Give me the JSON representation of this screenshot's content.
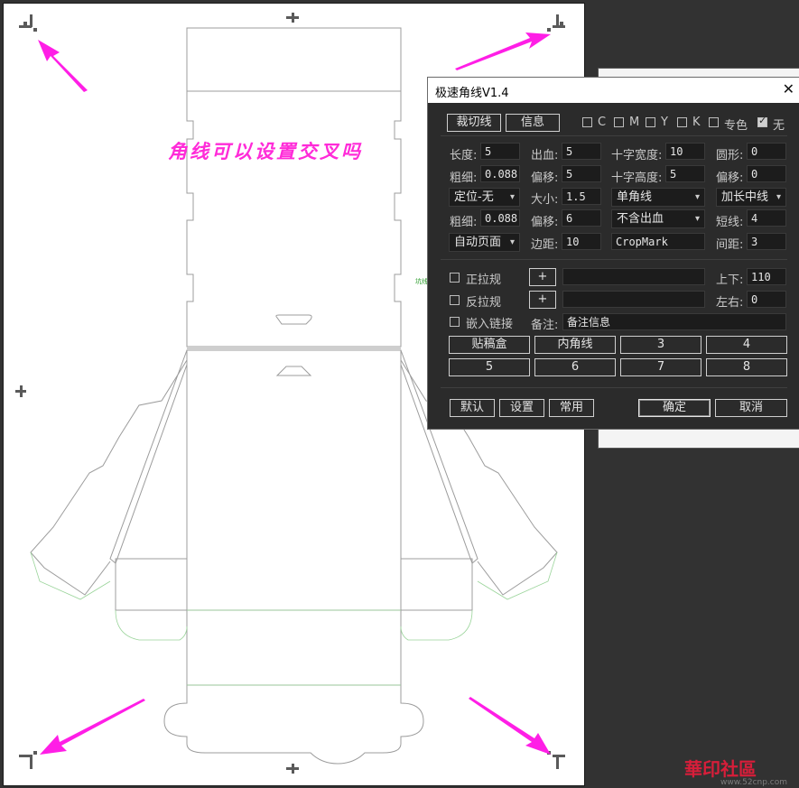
{
  "annotation_text": "角线可以设置交叉吗",
  "dialog": {
    "title": "极速角线V1.4",
    "close_glyph": "✕",
    "tabs": {
      "crop": "裁切线",
      "info": "信息"
    },
    "colors": [
      {
        "label": "C",
        "checked": false
      },
      {
        "label": "M",
        "checked": false
      },
      {
        "label": "Y",
        "checked": false
      },
      {
        "label": "K",
        "checked": false
      },
      {
        "label": "专色",
        "checked": false
      },
      {
        "label": "无",
        "checked": true
      }
    ],
    "row1": {
      "length_label": "长度:",
      "length_value": "5",
      "bleed_label": "出血:",
      "bleed_value": "5",
      "cross_width_label": "十字宽度:",
      "cross_width_value": "10",
      "circle_label": "圆形:",
      "circle_value": "0"
    },
    "row2": {
      "thickness_label": "粗细:",
      "thickness_value": "0.088",
      "offset_label": "偏移:",
      "offset_value": "5",
      "cross_height_label": "十字高度:",
      "cross_height_value": "5",
      "offset2_label": "偏移:",
      "offset2_value": "0"
    },
    "row3": {
      "position_select": "定位-无",
      "size_label": "大小:",
      "size_value": "1.5",
      "corner_select": "单角线",
      "midline_select": "加长中线"
    },
    "row4": {
      "thickness_label": "粗细:",
      "thickness_value": "0.088",
      "offset_label": "偏移:",
      "offset_value": "6",
      "bleed_select": "不含出血",
      "short_label": "短线:",
      "short_value": "4"
    },
    "row5": {
      "page_select": "自动页面",
      "margin_label": "边距:",
      "margin_value": "10",
      "name_value": "CropMark",
      "spacing_label": "间距:",
      "spacing_value": "3"
    },
    "guides": {
      "front_label": "正拉规",
      "front_checked": false,
      "front_plus": "+",
      "back_label": "反拉规",
      "back_checked": false,
      "back_plus": "+",
      "updown_label": "上下:",
      "updown_value": "110",
      "leftright_label": "左右:",
      "leftright_value": "0",
      "embed_label": "嵌入链接",
      "embed_checked": false,
      "note_label": "备注:",
      "note_value": "备注信息"
    },
    "presets": [
      "贴稿盒",
      "内角线",
      "3",
      "4",
      "5",
      "6",
      "7",
      "8"
    ],
    "footer": {
      "default_label": "默认",
      "settings_label": "设置",
      "common_label": "常用",
      "ok_label": "确定",
      "cancel_label": "取消"
    }
  },
  "watermark": {
    "text": "華印社區",
    "url": "www.52cnp.com"
  }
}
